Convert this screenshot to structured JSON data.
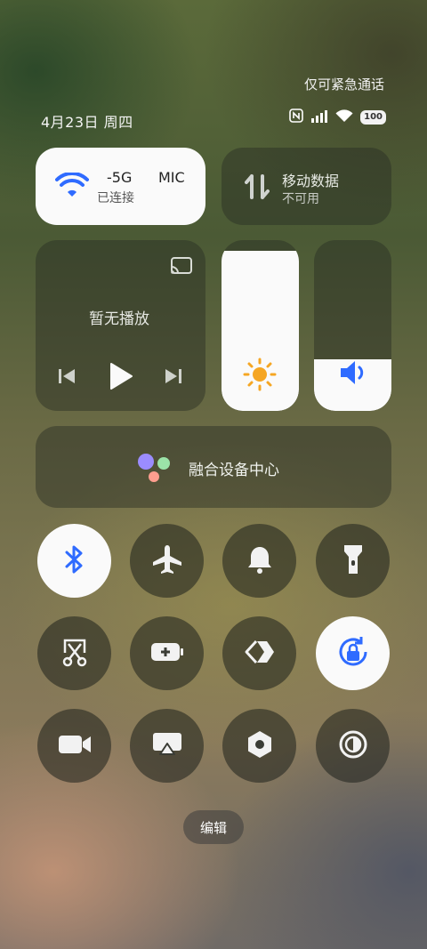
{
  "status": {
    "emergency_text": "仅可紧急通话",
    "date_text": "4月23日 周四",
    "battery": "100",
    "icons": [
      "nfc-icon",
      "signal-icon",
      "wifi-icon",
      "battery-icon"
    ]
  },
  "wifi_tile": {
    "title_left": "-5G",
    "title_right": "MIC",
    "subtitle": "已连接",
    "accent": "#2f6bff"
  },
  "mobile_tile": {
    "title": "移动数据",
    "subtitle": "不可用"
  },
  "media_tile": {
    "status": "暂无播放"
  },
  "sliders": {
    "brightness_level": 0.94,
    "volume_level": 0.3,
    "brightness_color": "#f5a623",
    "volume_color": "#2f6bff"
  },
  "fusion_tile": {
    "label": "融合设备中心"
  },
  "toggles": [
    {
      "name": "bluetooth",
      "icon": "bluetooth-icon",
      "on": true
    },
    {
      "name": "airplane-mode",
      "icon": "airplane-icon",
      "on": false
    },
    {
      "name": "ring-mode",
      "icon": "bell-icon",
      "on": false
    },
    {
      "name": "flashlight",
      "icon": "flashlight-icon",
      "on": false
    },
    {
      "name": "screenshot",
      "icon": "scissors-icon",
      "on": false
    },
    {
      "name": "battery-saver",
      "icon": "battery-plus-icon",
      "on": false
    },
    {
      "name": "nearby-share",
      "icon": "share-icon",
      "on": false
    },
    {
      "name": "rotation-lock",
      "icon": "rotation-lock-icon",
      "on": true
    },
    {
      "name": "screen-record",
      "icon": "video-icon",
      "on": false
    },
    {
      "name": "screen-cast",
      "icon": "cast-screen-icon",
      "on": false
    },
    {
      "name": "settings",
      "icon": "hexagon-gear-icon",
      "on": false
    },
    {
      "name": "dark-mode",
      "icon": "contrast-icon",
      "on": false
    }
  ],
  "edit_label": "编辑"
}
